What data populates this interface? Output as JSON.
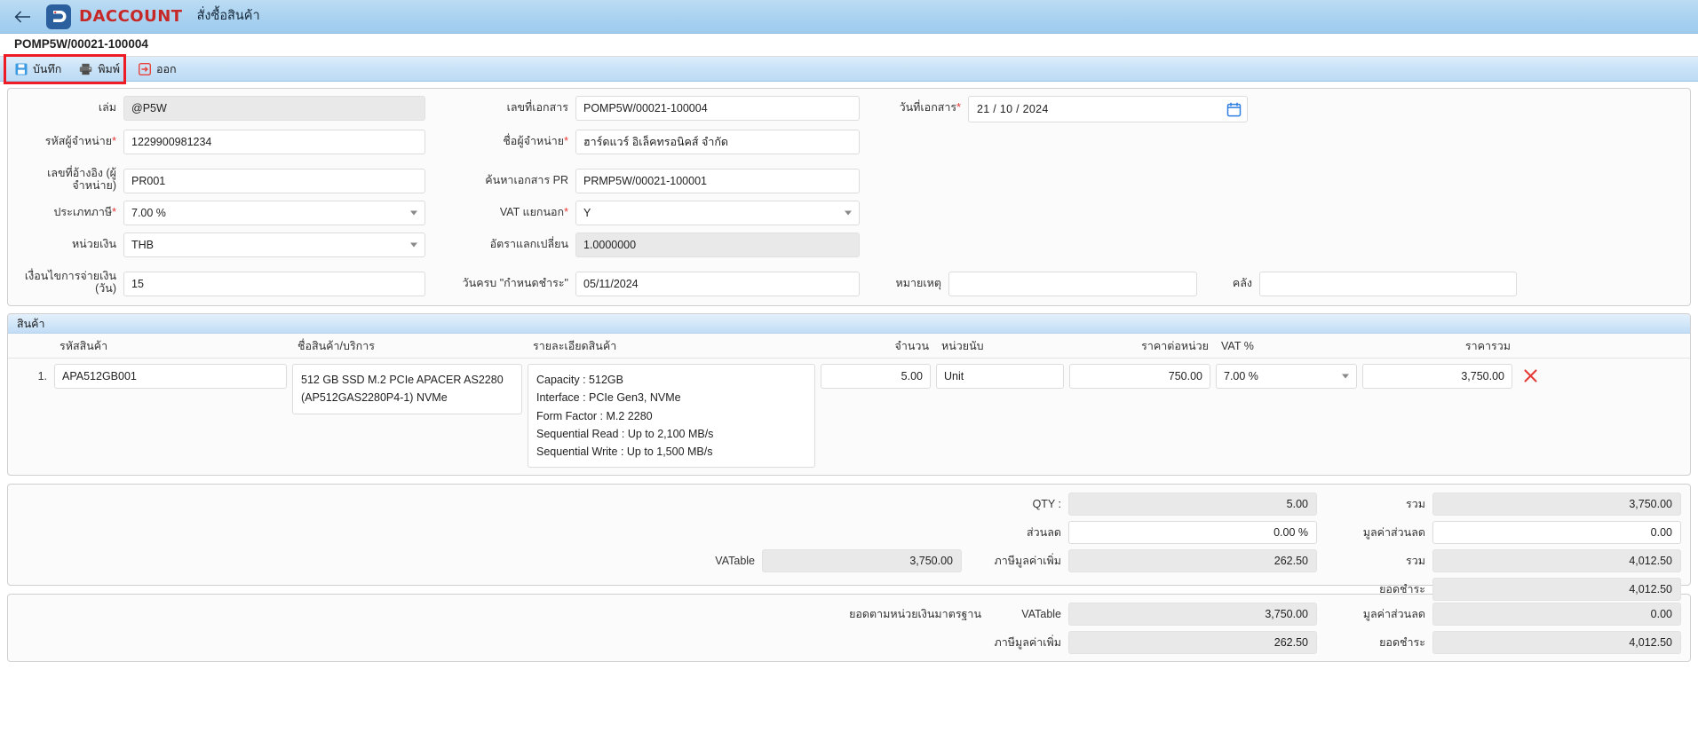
{
  "appbar": {
    "back_icon": "back-arrow-icon",
    "brand_word": "DACCOUNT",
    "title": "สั่งซื้อสินค้า"
  },
  "docbar": {
    "doc_no": "POMP5W/00021-100004"
  },
  "toolbar": {
    "save_label": "บันทึก",
    "print_label": "พิมพ์",
    "exit_label": "ออก"
  },
  "form": {
    "book_label": "เล่ม",
    "book_value": "@P5W",
    "docno_label": "เลขที่เอกสาร",
    "docno_value": "POMP5W/00021-100004",
    "docdate_label": "วันที่เอกสาร",
    "docdate_value": "21 / 10 /  2024",
    "vendor_code_label": "รหัสผู้จำหน่าย",
    "vendor_code_value": "1229900981234",
    "vendor_name_label": "ชื่อผู้จำหน่าย",
    "vendor_name_value": "ฮาร์ดแวร์ อิเล็คทรอนิคส์ จำกัด",
    "ref_label_l1": "เลขที่อ้างอิง (ผู้",
    "ref_label_l2": "จำหน่าย)",
    "ref_value": "PR001",
    "pr_search_label": "ค้นหาเอกสาร PR",
    "pr_search_value": "PRMP5W/00021-100001",
    "tax_type_label": "ประเภทภาษี",
    "tax_type_value": "7.00 %",
    "vat_out_label": "VAT แยกนอก",
    "vat_out_value": "Y",
    "currency_label": "หน่วยเงิน",
    "currency_value": "THB",
    "exrate_label": "อัตราแลกเปลี่ยน",
    "exrate_value": "1.0000000",
    "terms_label_l1": "เงื่อนไขการจ่ายเงิน",
    "terms_label_l2": "(วัน)",
    "terms_value": "15",
    "duedate_label": "วันครบ \"กำหนดชำระ\"",
    "duedate_value": "05/11/2024",
    "note_label": "หมายเหตุ",
    "note_value": "",
    "warehouse_label": "คลัง",
    "warehouse_value": ""
  },
  "items": {
    "section_title": "สินค้า",
    "columns": {
      "code": "รหัสสินค้า",
      "name": "ชื่อสินค้า/บริการ",
      "detail": "รายละเอียดสินค้า",
      "qty": "จำนวน",
      "unit": "หน่วยนับ",
      "unit_price": "ราคาต่อหน่วย",
      "vat_pct": "VAT %",
      "total": "ราคารวม"
    },
    "rows": [
      {
        "index": "1.",
        "code": "APA512GB001",
        "name": "512 GB SSD M.2 PCIe APACER AS2280 (AP512GAS2280P4-1) NVMe",
        "detail": "Capacity : 512GB\nInterface : PCIe Gen3, NVMe\nForm Factor : M.2 2280\nSequential Read : Up to 2,100 MB/s\nSequential Write : Up to 1,500 MB/s",
        "qty": "5.00",
        "unit": "Unit",
        "unit_price": "750.00",
        "vat_pct": "7.00 %",
        "total": "3,750.00",
        "delete_icon": "delete-x-icon"
      }
    ]
  },
  "summary": {
    "qty_label": "QTY :",
    "qty_value": "5.00",
    "total_label": "รวม",
    "total_value": "3,750.00",
    "discount_label": "ส่วนลด",
    "discount_value": "0.00 %",
    "discount_amt_label": "มูลค่าส่วนลด",
    "discount_amt_value": "0.00",
    "vatable_label": "VATable",
    "vatable_value": "3,750.00",
    "vat_label": "ภาษีมูลค่าเพิ่ม",
    "vat_value": "262.50",
    "grand_label": "รวม",
    "grand_value": "4,012.50",
    "payable_label": "ยอดชำระ",
    "payable_value": "4,012.50"
  },
  "base_summary": {
    "title": "ยอดตามหน่วยเงินมาตรฐาน",
    "vatable_label": "VATable",
    "vatable_value": "3,750.00",
    "discount_amt_label": "มูลค่าส่วนลด",
    "discount_amt_value": "0.00",
    "vat_label": "ภาษีมูลค่าเพิ่ม",
    "vat_value": "262.50",
    "payable_label": "ยอดชำระ",
    "payable_value": "4,012.50"
  },
  "colors": {
    "appbar": "#a9d2f0",
    "brand_red": "#c62828",
    "required_red": "#e53935",
    "highlight_red": "#ee1c24",
    "section_band": "#cfe5f8"
  }
}
